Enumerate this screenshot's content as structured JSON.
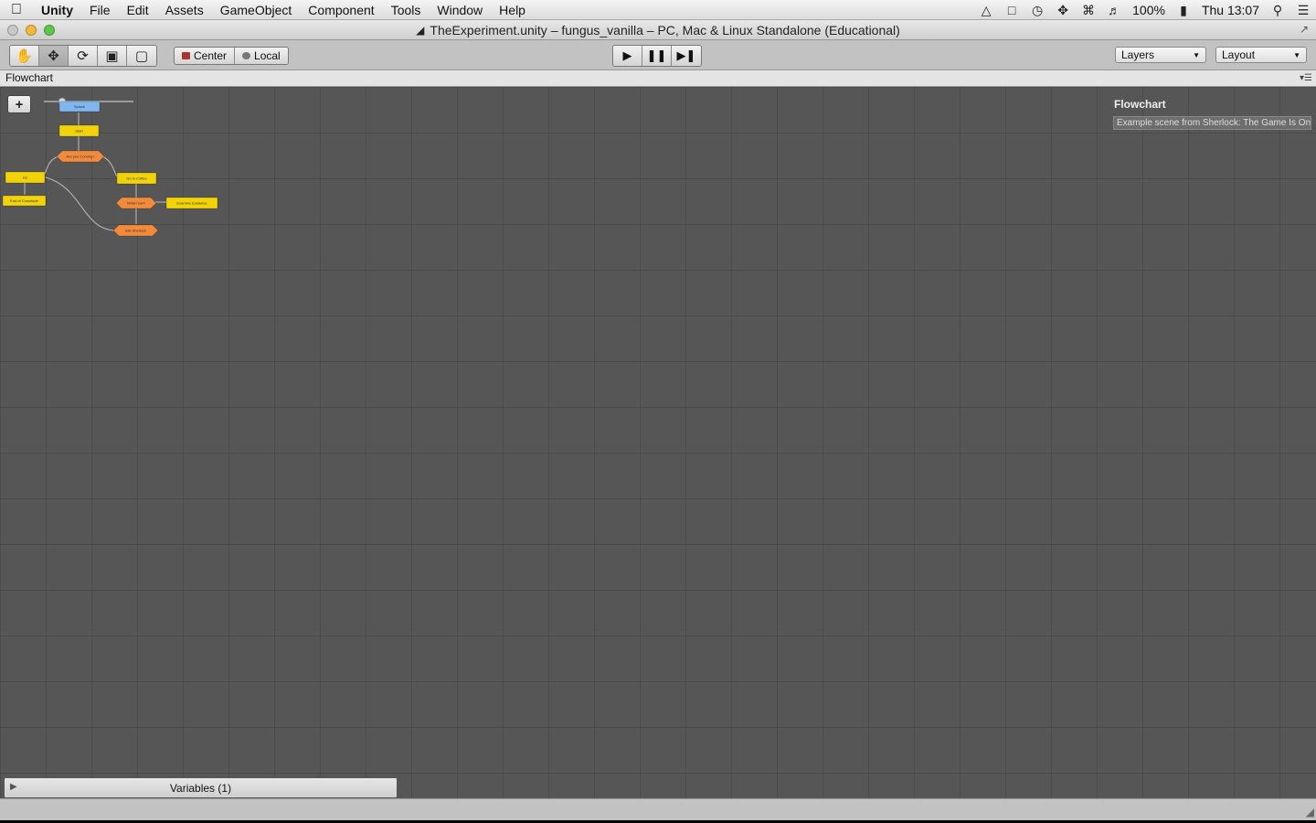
{
  "menubar": {
    "app_name": "Unity",
    "items": [
      "File",
      "Edit",
      "Assets",
      "GameObject",
      "Component",
      "Tools",
      "Window",
      "Help"
    ],
    "battery": "100%",
    "clock": "Thu 13:07"
  },
  "window": {
    "title": "TheExperiment.unity – fungus_vanilla – PC, Mac & Linux Standalone (Educational)"
  },
  "toolbar": {
    "pivot_center": "Center",
    "pivot_local": "Local",
    "layers_label": "Layers",
    "layout_label": "Layout"
  },
  "panel": {
    "tab_title": "Flowchart"
  },
  "flowchart": {
    "info_title": "Flowchart",
    "info_description": "Example scene from Sherlock: The Game Is On",
    "nodes": [
      {
        "label": "Splash",
        "kind": "event"
      },
      {
        "label": "Start",
        "kind": "block"
      },
      {
        "label": "Are you Coming?",
        "kind": "choice"
      },
      {
        "label": "Go",
        "kind": "block"
      },
      {
        "label": "Go in Coffee",
        "kind": "block"
      },
      {
        "label": "End of Crossfade",
        "kind": "block"
      },
      {
        "label": "What now?",
        "kind": "choice"
      },
      {
        "label": "Examine Evidence",
        "kind": "block"
      },
      {
        "label": "Ask Sherlock",
        "kind": "choice"
      }
    ]
  },
  "variables": {
    "label": "Variables (1)"
  },
  "colors": {
    "canvas_bg": "#565656",
    "block_yellow": "#f2d30a",
    "choice_orange": "#f28a3c",
    "event_blue": "#7fb6f0"
  }
}
